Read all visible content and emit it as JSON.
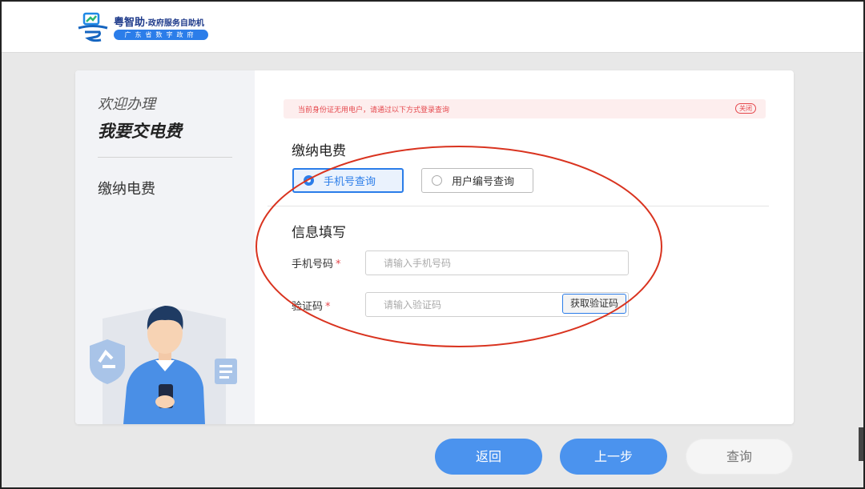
{
  "header": {
    "brand_name": "粤智助",
    "brand_subtitle": "·政府服务自助机",
    "brand_tag": "广东省数字政府"
  },
  "sidebar": {
    "welcome": "欢迎办理",
    "service_title": "我要交电费",
    "nav_item": "缴纳电费"
  },
  "notice": {
    "text": "当前身份证无用电户，请通过以下方式登录查询",
    "close_label": "关闭"
  },
  "section_payment": {
    "title": "缴纳电费",
    "options": [
      {
        "label": "手机号查询",
        "selected": true
      },
      {
        "label": "用户编号查询",
        "selected": false
      }
    ]
  },
  "section_info": {
    "title": "信息填写",
    "phone_label": "手机号码",
    "phone_placeholder": "请输入手机号码",
    "phone_value": "",
    "code_label": "验证码",
    "code_placeholder": "请输入验证码",
    "code_value": "",
    "required_mark": "*",
    "get_code_label": "获取验证码"
  },
  "footer": {
    "back_label": "返回",
    "prev_label": "上一步",
    "query_label": "查询"
  },
  "colors": {
    "accent": "#2b7de9",
    "button_blue": "#4b93ee",
    "error_red": "#e5484d",
    "annotation_red": "#d9331f"
  }
}
